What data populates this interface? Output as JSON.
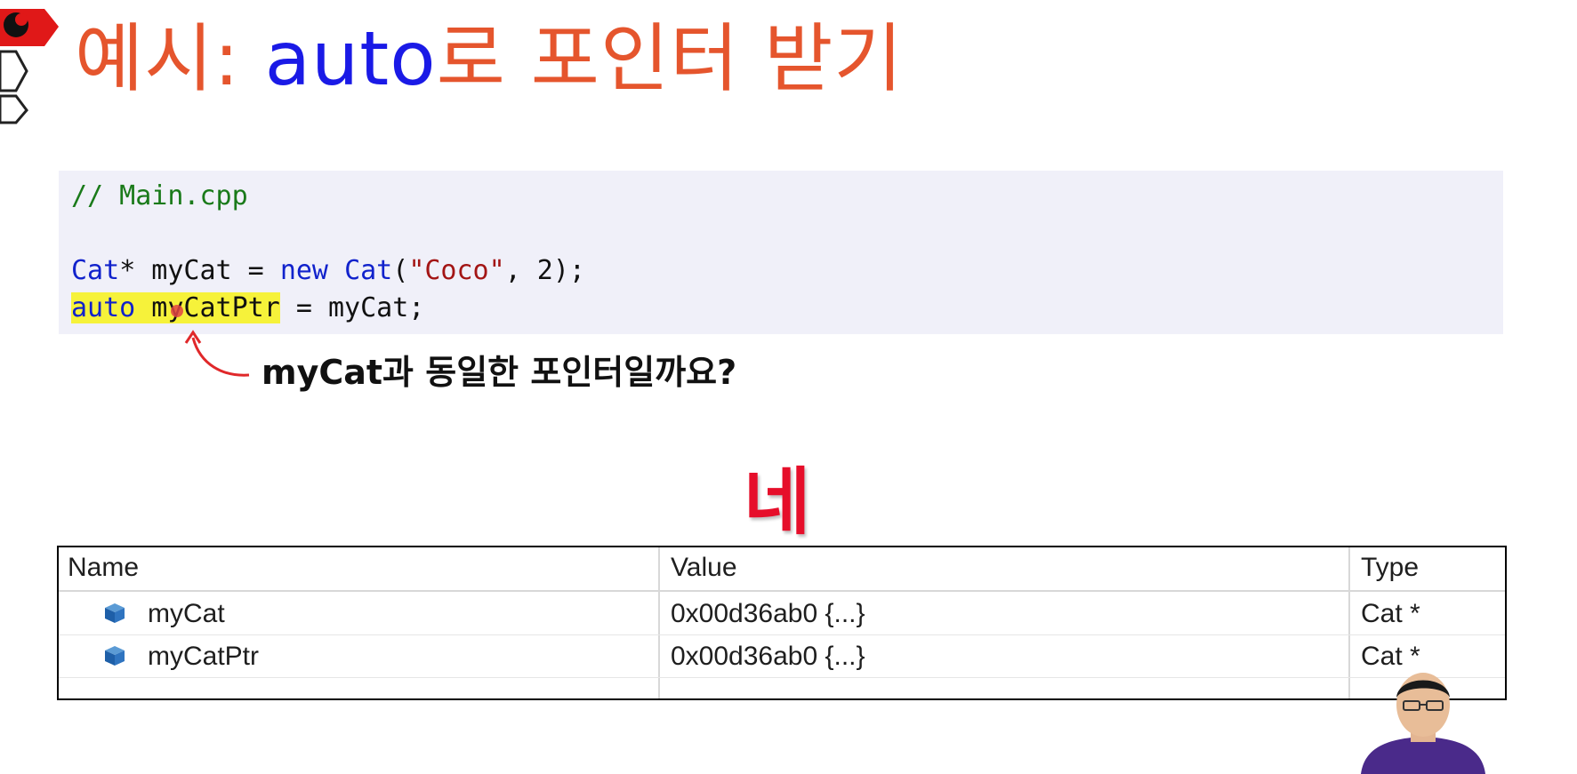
{
  "title": {
    "prefix": "예시: ",
    "keyword": "auto",
    "suffix": "로 포인터 받기"
  },
  "code": {
    "comment": "// Main.cpp",
    "line2": {
      "t1": "Cat",
      "t2": "* myCat = ",
      "t3": "new",
      "t4": " ",
      "t5": "Cat",
      "t6": "(",
      "t7": "\"Coco\"",
      "t8": ", 2);"
    },
    "line3": {
      "kw": "auto",
      "hl_rest": " myCatPtr",
      "rest": " = myCat;"
    }
  },
  "annotation": {
    "question": "myCat과 동일한 포인터일까요?",
    "answer": "네"
  },
  "watch": {
    "columns": [
      "Name",
      "Value",
      "Type"
    ],
    "rows": [
      {
        "name": "myCat",
        "value": "0x00d36ab0 {...}",
        "type": "Cat *"
      },
      {
        "name": "myCatPtr",
        "value": "0x00d36ab0 {...}",
        "type": "Cat *"
      }
    ]
  },
  "icons": {
    "logo": "brain-logo-icon",
    "variable": "variable-cube-icon"
  },
  "colors": {
    "title": "#e5552d",
    "keyword": "#1a1ae6",
    "highlight": "#f6f23a",
    "answer": "#e60e2a"
  }
}
